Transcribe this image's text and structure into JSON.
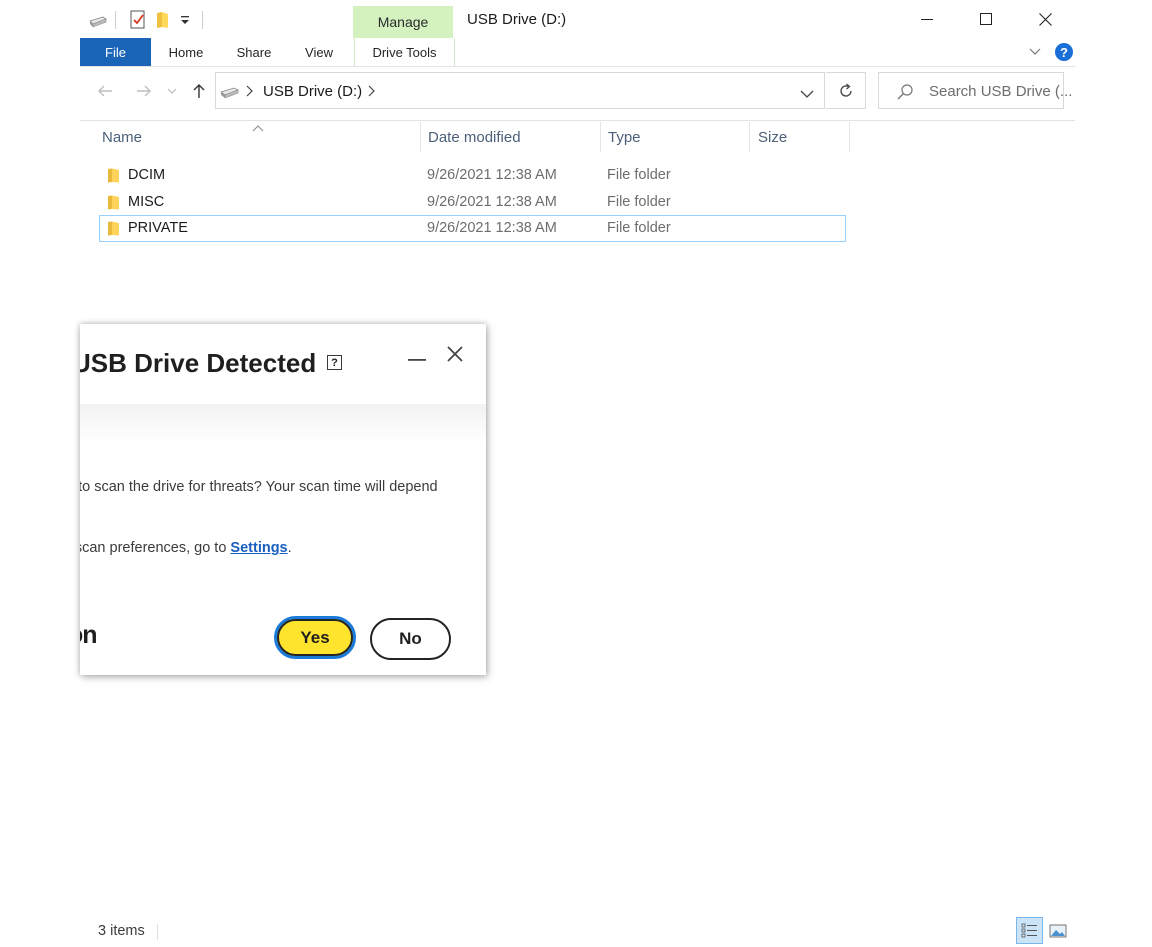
{
  "window": {
    "title": "USB Drive (D:)",
    "minimize": "minimize",
    "maximize": "maximize",
    "close": "close"
  },
  "ribbon": {
    "contextual_group": "Manage",
    "tabs": [
      "File",
      "Home",
      "Share",
      "View",
      "Drive Tools"
    ]
  },
  "address": {
    "path": "USB Drive (D:)",
    "search_placeholder": "Search USB Drive (..."
  },
  "columns": [
    "Name",
    "Date modified",
    "Type",
    "Size"
  ],
  "files": [
    {
      "name": "DCIM",
      "date": "9/26/2021 12:38 AM",
      "type": "File folder"
    },
    {
      "name": "MISC",
      "date": "9/26/2021 12:38 AM",
      "type": "File folder"
    },
    {
      "name": "PRIVATE",
      "date": "9/26/2021 12:38 AM",
      "type": "File folder",
      "selected": true
    }
  ],
  "dialog": {
    "title": "USB Drive Detected",
    "help_label": "?",
    "line1": "e to scan the drive for threats? Your scan time will depend",
    "line2_pre": "r scan preferences, go to ",
    "line2_link": "Settings",
    "line2_post": ".",
    "brand_fragment": "on",
    "yes": "Yes",
    "no": "No"
  },
  "status": {
    "item_count": "3 items"
  },
  "colors": {
    "file_tab": "#1a65b8",
    "manage_tab": "#d4f1c0",
    "selection_border": "#99d1ff",
    "yes_button": "#ffe42e",
    "focus_ring": "#1a7bdb",
    "link": "#1a5fbf"
  },
  "icons": [
    "drive-icon",
    "properties-icon",
    "new-folder-icon",
    "customize-dropdown-icon",
    "back-arrow-icon",
    "forward-arrow-icon",
    "recent-dropdown-icon",
    "up-arrow-icon",
    "chevron-right-icon",
    "chevron-down-icon",
    "refresh-icon",
    "search-icon",
    "folder-icon",
    "sort-up-icon",
    "help-icon",
    "details-view-icon",
    "large-icons-view-icon"
  ]
}
